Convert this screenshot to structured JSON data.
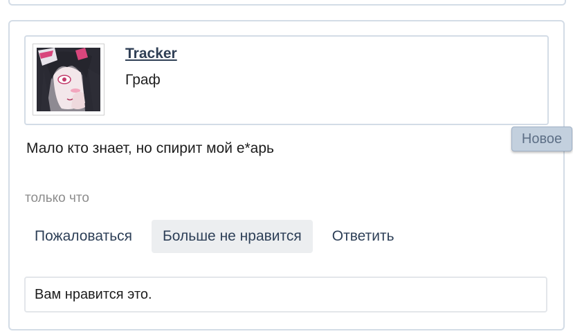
{
  "post": {
    "author": {
      "username": "Tracker",
      "title": "Граф",
      "avatar_icon": "anime-girl-avatar"
    },
    "badge": "Новое",
    "message": "Мало кто знает, но спирит мой е*арь",
    "timestamp": "только что",
    "actions": {
      "report": "Пожаловаться",
      "unlike": "Больше не нравится",
      "reply": "Ответить"
    },
    "likes_text": "Вам нравится это."
  },
  "colors": {
    "border": "#d3dce6",
    "link": "#2f3f55",
    "badge_bg": "#c3d0de"
  }
}
